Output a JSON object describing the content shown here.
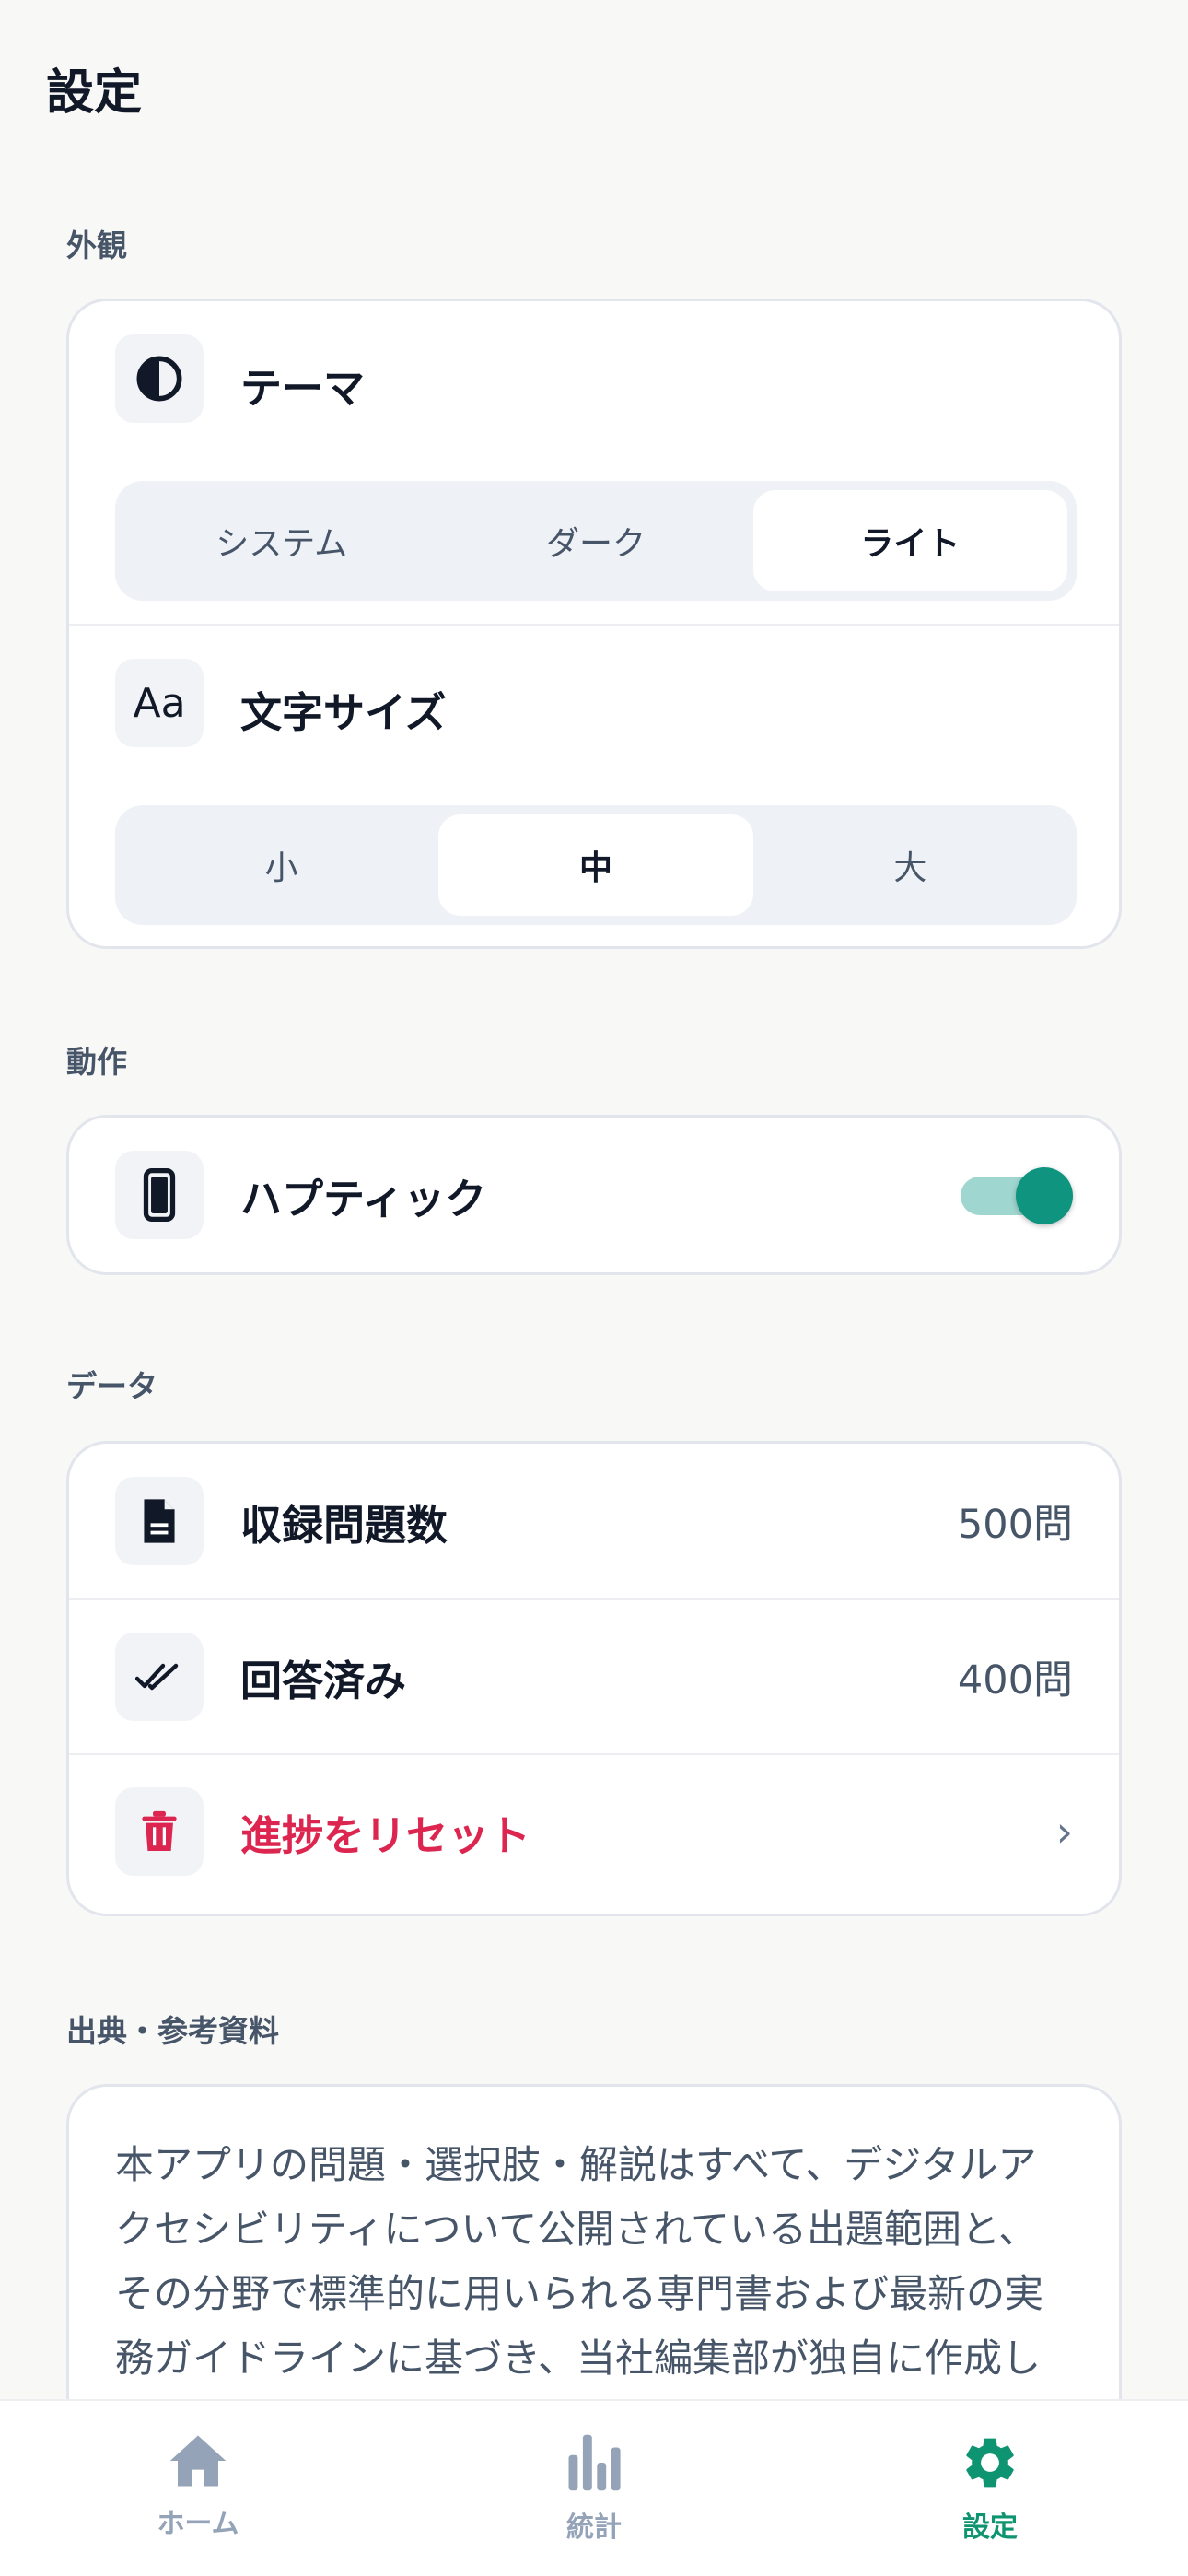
{
  "page_title": "設定",
  "sections": {
    "appearance": {
      "label": "外観",
      "theme": {
        "label": "テーマ",
        "icon": "contrast-icon",
        "options": [
          "システム",
          "ダーク",
          "ライト"
        ],
        "selected": "ライト"
      },
      "font_size": {
        "label": "文字サイズ",
        "icon_text": "Aa",
        "options": [
          "小",
          "中",
          "大"
        ],
        "selected": "中"
      }
    },
    "behavior": {
      "label": "動作",
      "haptic": {
        "label": "ハプティック",
        "icon": "phone-icon",
        "enabled": true
      }
    },
    "data": {
      "label": "データ",
      "question_count": {
        "label": "収録問題数",
        "value": "500問",
        "icon": "document-icon"
      },
      "answered": {
        "label": "回答済み",
        "value": "400問",
        "icon": "double-check-icon"
      },
      "reset": {
        "label": "進捗をリセット",
        "icon": "trash-icon",
        "chevron": "›"
      }
    },
    "references": {
      "label": "出典・参考資料",
      "text": "本アプリの問題・選択肢・解説はすべて、デジタルアクセシビリティについて公開されている出題範囲と、 その分野で標準的に用いられる専門書および最新の実務ガイドラインに基づき、当社編集部が独自に作成したオリジナル試験実施機関の公式問題を"
    }
  },
  "tabbar": {
    "items": [
      {
        "label": "ホーム",
        "icon": "home-icon"
      },
      {
        "label": "統計",
        "icon": "bar-chart-icon"
      },
      {
        "label": "設定",
        "icon": "gear-icon"
      }
    ],
    "active": "設定"
  },
  "colors": {
    "accent": "#0f9480",
    "danger": "#dc2650",
    "toggle_track": "#9fd6cf",
    "background": "#f8f8f7"
  }
}
